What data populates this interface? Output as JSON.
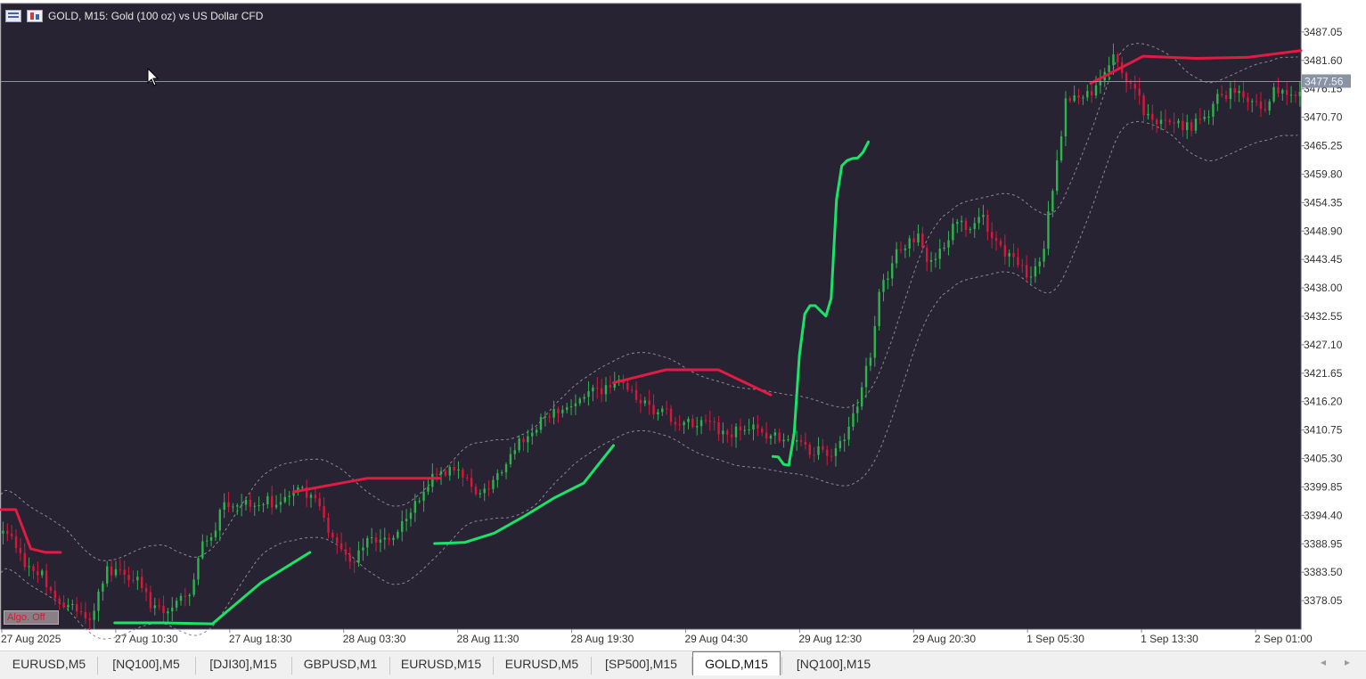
{
  "window": {
    "title": "GOLD, M15:  Gold (100 oz) vs US Dollar CFD",
    "algo_badge": "Algo. Off"
  },
  "colors": {
    "background": "#272333",
    "bull_candle": "#2fb34d",
    "bear_candle": "#d8173a",
    "upper_band": "#e01b44",
    "lower_band": "#19e468",
    "envelope": "#8a8892",
    "axis_text": "#cfcfd6",
    "price_line": "#8793a3",
    "price_label_bg": "#8a93a3"
  },
  "chart_data": {
    "type": "candlestick",
    "symbol": "GOLD",
    "timeframe": "M15",
    "ylim": [
      3372.6,
      3492.5
    ],
    "current_price": "3477.56",
    "y_ticks": [
      "3487.05",
      "3481.60",
      "3476.15",
      "3470.70",
      "3465.25",
      "3459.80",
      "3454.35",
      "3448.90",
      "3443.45",
      "3438.00",
      "3432.55",
      "3427.10",
      "3421.65",
      "3416.20",
      "3410.75",
      "3405.30",
      "3399.85",
      "3394.40",
      "3388.95",
      "3383.50",
      "3378.05"
    ],
    "x_ticks": [
      "27 Aug 2025",
      "27 Aug 10:30",
      "27 Aug 18:30",
      "28 Aug 03:30",
      "28 Aug 11:30",
      "28 Aug 19:30",
      "29 Aug 04:30",
      "29 Aug 12:30",
      "29 Aug 20:30",
      "1 Sep 05:30",
      "1 Sep 13:30",
      "2 Sep 01:00"
    ],
    "key_closes": [
      [
        0,
        3392
      ],
      [
        30,
        3384
      ],
      [
        60,
        3377
      ],
      [
        80,
        3375
      ],
      [
        100,
        3384
      ],
      [
        122,
        3383
      ],
      [
        145,
        3376
      ],
      [
        170,
        3378
      ],
      [
        190,
        3390
      ],
      [
        210,
        3397
      ],
      [
        240,
        3397
      ],
      [
        255,
        3397
      ],
      [
        275,
        3399
      ],
      [
        290,
        3397
      ],
      [
        305,
        3390
      ],
      [
        325,
        3386
      ],
      [
        340,
        3390
      ],
      [
        360,
        3389
      ],
      [
        380,
        3396
      ],
      [
        400,
        3402
      ],
      [
        420,
        3404
      ],
      [
        440,
        3398
      ],
      [
        460,
        3402
      ],
      [
        480,
        3409
      ],
      [
        510,
        3414
      ],
      [
        530,
        3416
      ],
      [
        550,
        3418
      ],
      [
        570,
        3420
      ],
      [
        590,
        3416
      ],
      [
        610,
        3414
      ],
      [
        630,
        3412
      ],
      [
        650,
        3412
      ],
      [
        670,
        3410
      ],
      [
        690,
        3411
      ],
      [
        710,
        3410
      ],
      [
        730,
        3408
      ],
      [
        750,
        3407
      ],
      [
        760,
        3406
      ],
      [
        775,
        3408
      ],
      [
        790,
        3416
      ],
      [
        800,
        3425
      ],
      [
        815,
        3440
      ],
      [
        830,
        3446
      ],
      [
        845,
        3448
      ],
      [
        855,
        3444
      ],
      [
        870,
        3445
      ],
      [
        880,
        3452
      ],
      [
        890,
        3449
      ],
      [
        905,
        3451
      ],
      [
        920,
        3446
      ],
      [
        935,
        3443
      ],
      [
        950,
        3440
      ],
      [
        960,
        3444
      ],
      [
        970,
        3456
      ],
      [
        975,
        3464
      ],
      [
        982,
        3474
      ],
      [
        995,
        3474
      ],
      [
        1010,
        3476
      ],
      [
        1020,
        3480
      ],
      [
        1027,
        3484
      ],
      [
        1035,
        3478
      ],
      [
        1045,
        3476
      ],
      [
        1055,
        3472
      ],
      [
        1065,
        3469
      ],
      [
        1080,
        3470
      ],
      [
        1095,
        3469
      ],
      [
        1110,
        3470
      ],
      [
        1125,
        3475
      ],
      [
        1140,
        3476
      ],
      [
        1155,
        3474
      ],
      [
        1165,
        3472
      ],
      [
        1175,
        3476
      ],
      [
        1185,
        3475
      ],
      [
        1199,
        3476
      ]
    ],
    "upper_band": [
      {
        "x": [
          0,
          55
        ],
        "y": [
          3395.5,
          3395.5,
          3388,
          3387.3,
          3387.3
        ]
      },
      {
        "x": [
          270,
          405
        ],
        "y": [
          3398.9,
          3401.5,
          3401.5
        ]
      },
      {
        "x": [
          565,
          710
        ],
        "y": [
          3419.8,
          3422.3,
          3422.3,
          3417.5
        ]
      },
      {
        "x": [
          1005,
          1199
        ],
        "y": [
          3477.2,
          3482.4,
          3482.0,
          3482.2,
          3483.5
        ]
      }
    ],
    "lower_band": [
      {
        "x": [
          105,
          285
        ],
        "y": [
          3373.8,
          3373.8,
          3373.6,
          3381.5,
          3387.3
        ]
      },
      {
        "x": [
          400,
          565
        ],
        "y": [
          3389.0,
          3389.2,
          3391.0,
          3394.2,
          3397.7,
          3400.6,
          3407.8
        ]
      },
      {
        "x": [
          712,
          800
        ],
        "y": [
          3405.7,
          3405.6,
          3404.2,
          3404.0,
          3410.0,
          3425.0,
          3433.0,
          3434.6,
          3434.6,
          3433.6,
          3432.6,
          3436.0,
          3455.0,
          3461.4,
          3462.4,
          3462.8,
          3462.9,
          3464.0,
          3466.0
        ]
      }
    ]
  },
  "tabs": [
    {
      "label": "EURUSD,M5",
      "active": false
    },
    {
      "label": "[NQ100],M5",
      "active": false
    },
    {
      "label": "[DJI30],M15",
      "active": false
    },
    {
      "label": "GBPUSD,M1",
      "active": false
    },
    {
      "label": "EURUSD,M15",
      "active": false
    },
    {
      "label": "EURUSD,M5",
      "active": false
    },
    {
      "label": "[SP500],M15",
      "active": false
    },
    {
      "label": "GOLD,M15",
      "active": true
    },
    {
      "label": "[NQ100],M15",
      "active": false
    }
  ],
  "tab_nav": {
    "left": "◂",
    "right": "▸"
  }
}
